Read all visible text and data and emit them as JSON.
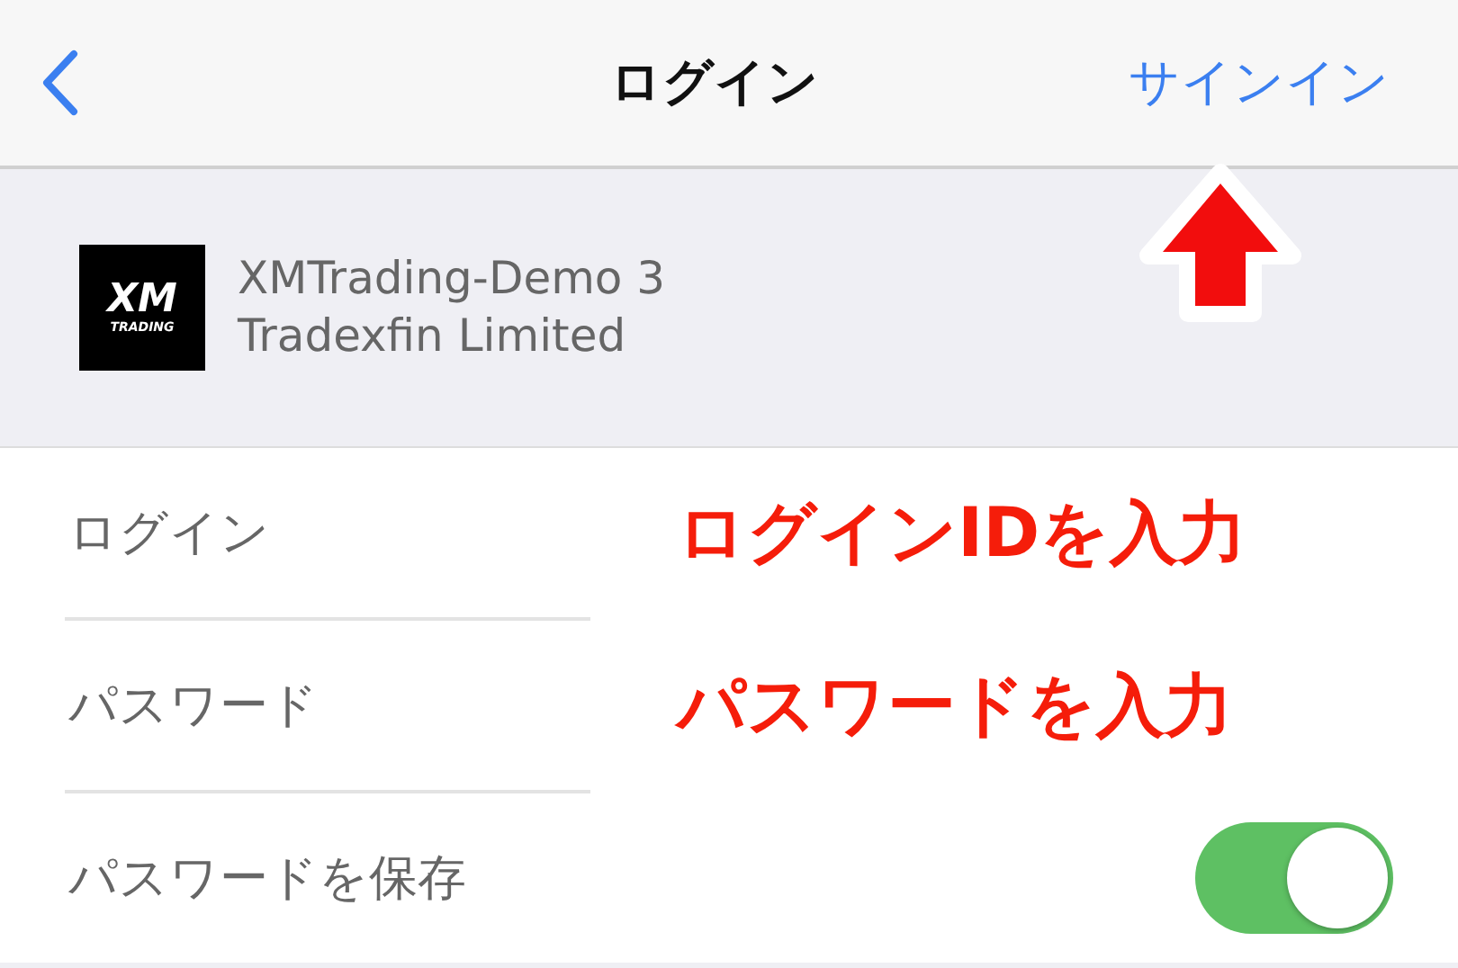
{
  "nav": {
    "title": "ログイン",
    "action": "サインイン"
  },
  "server": {
    "logo": {
      "mark": "XM",
      "caption": "TRADING"
    },
    "name": "XMTrading-Demo 3",
    "company": "Tradexfin Limited"
  },
  "rows": [
    {
      "kind": "field",
      "label": "ログイン",
      "annotation": "ログインIDを入力"
    },
    {
      "kind": "field",
      "label": "パスワード",
      "annotation": "パスワードを入力"
    },
    {
      "kind": "toggle",
      "label": "パスワードを保存",
      "on": true
    }
  ],
  "callout": {
    "kind": "arrow"
  }
}
